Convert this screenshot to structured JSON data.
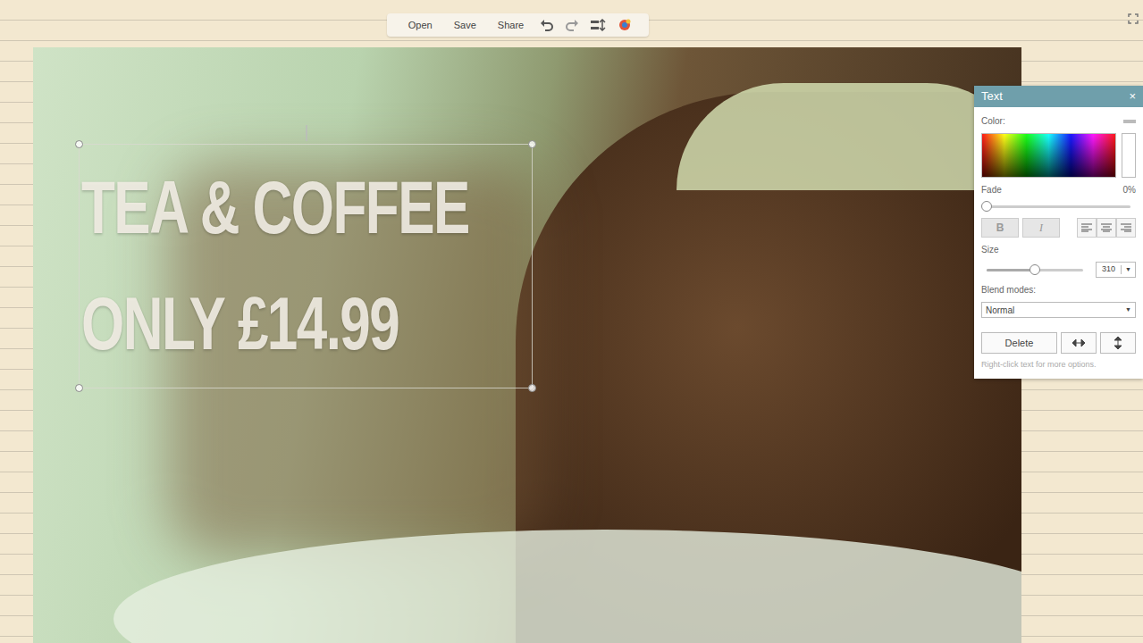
{
  "toolbar": {
    "buttons": [
      {
        "label": "Open"
      },
      {
        "label": "Save"
      },
      {
        "label": "Share"
      }
    ]
  },
  "canvas": {
    "text_layer": {
      "lines": [
        "TEA & COFFEE",
        "ONLY £14.99"
      ],
      "selected": true
    }
  },
  "text_panel": {
    "title": "Text",
    "close": "×",
    "color_label": "Color:",
    "fade": {
      "label": "Fade",
      "reading": "0%",
      "level": 0
    },
    "bold": {
      "label": "B"
    },
    "italic": {
      "label": "I"
    },
    "size": {
      "label": "Size",
      "level": 0.5,
      "value": "310"
    },
    "blend": {
      "label": "Blend modes:",
      "value": "Normal"
    },
    "delete": "Delete",
    "hint": "Right-click text for more options."
  }
}
